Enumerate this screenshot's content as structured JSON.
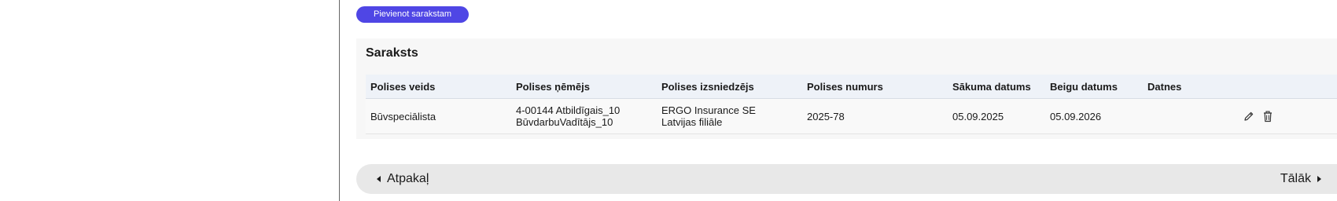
{
  "toolbar": {
    "add_label": "Pievienot sarakstam"
  },
  "list": {
    "title": "Saraksts",
    "columns": [
      "Polises veids",
      "Polises ņēmējs",
      "Polises izsniedzējs",
      "Polises numurs",
      "Sākuma datums",
      "Beigu datums",
      "Datnes"
    ],
    "rows": [
      {
        "type": "Būvspeciālista",
        "holder_line1": "4-00144 Atbildīgais_10",
        "holder_line2": "BūvdarbuVadītājs_10",
        "issuer_line1": "ERGO Insurance SE",
        "issuer_line2": "Latvijas filiāle",
        "number": "2025-78",
        "start_date": "05.09.2025",
        "end_date": "05.09.2026",
        "files": ""
      }
    ]
  },
  "nav": {
    "back_label": "Atpakaļ",
    "next_label": "Tālāk"
  },
  "colors": {
    "accent": "#4f46e5",
    "header_bg": "#eef2f8",
    "card_bg": "#f7f7f7",
    "nav_bg": "#e8e8e8"
  },
  "icons": {
    "edit": "pencil-icon",
    "delete": "trash-icon",
    "back": "triangle-left-icon",
    "next": "triangle-right-icon"
  }
}
